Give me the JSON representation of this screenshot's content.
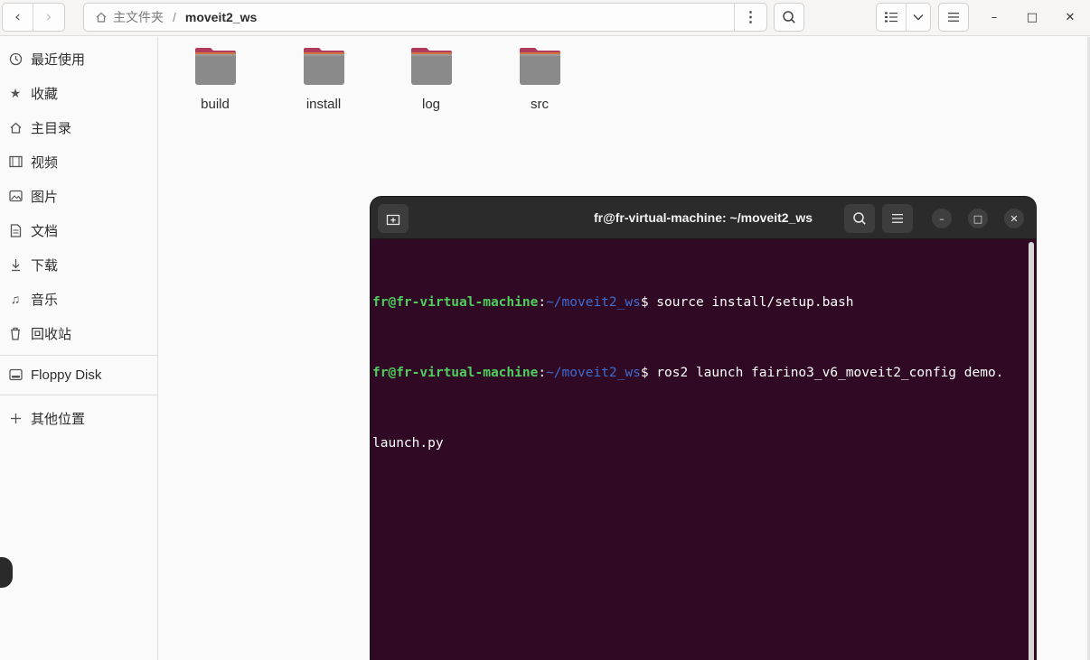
{
  "filemanager": {
    "nav": {
      "back": "‹",
      "forward": "›"
    },
    "path": {
      "home_label": "主文件夹",
      "separator": "/",
      "current": "moveit2_ws",
      "more_glyph": "⋮"
    },
    "window_controls": {
      "minimize": "–",
      "maximize": "□",
      "close": "✕"
    }
  },
  "sidebar": {
    "items": [
      {
        "label": "最近使用",
        "icon": "clock-icon"
      },
      {
        "label": "收藏",
        "icon": "star-icon"
      },
      {
        "label": "主目录",
        "icon": "home-icon"
      },
      {
        "label": "视频",
        "icon": "film-icon"
      },
      {
        "label": "图片",
        "icon": "image-icon"
      },
      {
        "label": "文档",
        "icon": "document-icon"
      },
      {
        "label": "下载",
        "icon": "download-icon"
      },
      {
        "label": "音乐",
        "icon": "music-icon"
      },
      {
        "label": "回收站",
        "icon": "trash-icon"
      },
      {
        "label": "Floppy Disk",
        "icon": "drive-icon"
      },
      {
        "label": "其他位置",
        "icon": "plus-icon"
      }
    ]
  },
  "files": [
    {
      "name": "build"
    },
    {
      "name": "install"
    },
    {
      "name": "log"
    },
    {
      "name": "src"
    }
  ],
  "terminal": {
    "title": "fr@fr-virtual-machine: ~/moveit2_ws",
    "lines": [
      {
        "user": "fr@fr-virtual-machine",
        "colon": ":",
        "path": "~/moveit2_ws",
        "dollar": "$ ",
        "cmd": "source install/setup.bash"
      },
      {
        "user": "fr@fr-virtual-machine",
        "colon": ":",
        "path": "~/moveit2_ws",
        "dollar": "$ ",
        "cmd": "ros2 launch fairino3_v6_moveit2_config demo."
      },
      {
        "cmd": "launch.py"
      }
    ],
    "window_controls": {
      "minimize": "–",
      "maximize": "□",
      "close": "✕"
    }
  },
  "colors": {
    "terminal_bg": "#300a24",
    "prompt_user": "#4fce5d",
    "prompt_path": "#3f6ccf",
    "folder_top": "#b03a5b",
    "folder_body": "#8a8a8a"
  }
}
